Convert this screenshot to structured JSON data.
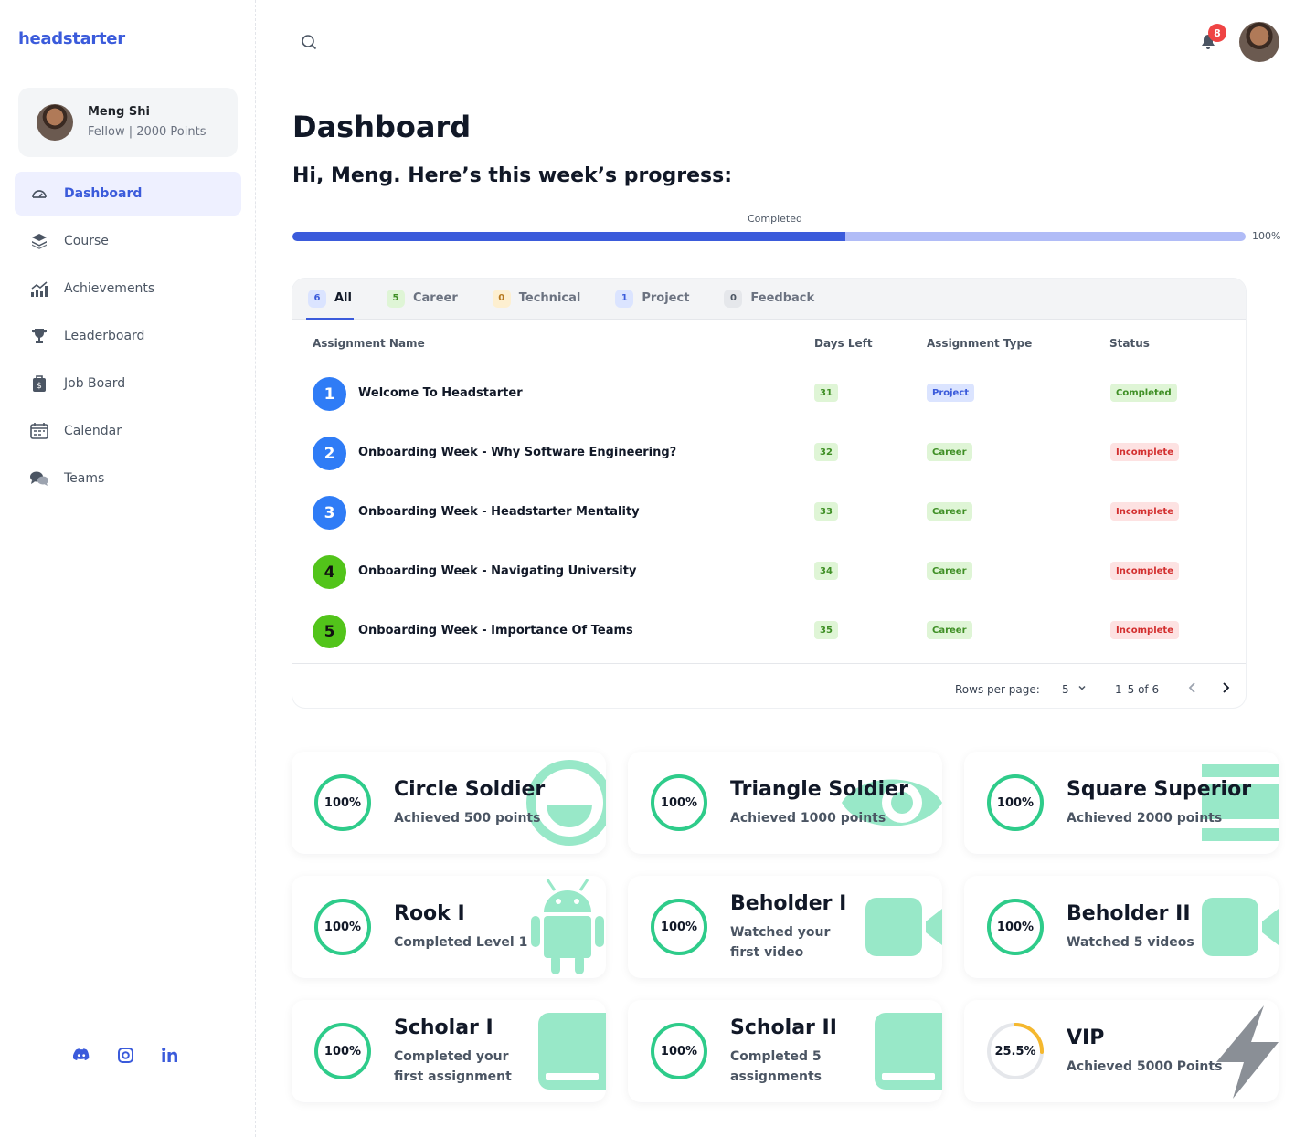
{
  "brand": "headstarter",
  "profile": {
    "name": "Meng Shi",
    "meta": "Fellow | 2000 Points"
  },
  "nav": [
    {
      "label": "Dashboard",
      "icon": "gauge-icon",
      "active": true
    },
    {
      "label": "Course",
      "icon": "layers-icon"
    },
    {
      "label": "Achievements",
      "icon": "chart-icon"
    },
    {
      "label": "Leaderboard",
      "icon": "trophy-icon"
    },
    {
      "label": "Job Board",
      "icon": "briefcase-icon"
    },
    {
      "label": "Calendar",
      "icon": "calendar-icon"
    },
    {
      "label": "Teams",
      "icon": "chat-icon"
    }
  ],
  "socials": [
    "discord-icon",
    "instagram-icon",
    "linkedin-icon"
  ],
  "notifications": {
    "count": "8"
  },
  "page": {
    "title": "Dashboard",
    "greeting": "Hi, Meng. Here’s this week’s progress:"
  },
  "progress": {
    "label": "Completed",
    "percent_text": "100%",
    "fill_fraction": 0.58
  },
  "tabs": [
    {
      "count": "6",
      "label": "All",
      "active": true
    },
    {
      "count": "5",
      "label": "Career"
    },
    {
      "count": "0",
      "label": "Technical"
    },
    {
      "count": "1",
      "label": "Project"
    },
    {
      "count": "0",
      "label": "Feedback"
    }
  ],
  "columns": [
    "Assignment Name",
    "Days Left",
    "Assignment Type",
    "Status"
  ],
  "assignments": [
    {
      "n": "1",
      "name": "Welcome To Headstarter",
      "days": "31",
      "type": "Project",
      "status": "Completed"
    },
    {
      "n": "2",
      "name": "Onboarding Week - Why Software Engineering?",
      "days": "32",
      "type": "Career",
      "status": "Incomplete"
    },
    {
      "n": "3",
      "name": "Onboarding Week - Headstarter Mentality",
      "days": "33",
      "type": "Career",
      "status": "Incomplete"
    },
    {
      "n": "4",
      "name": "Onboarding Week - Navigating University",
      "days": "34",
      "type": "Career",
      "status": "Incomplete"
    },
    {
      "n": "5",
      "name": "Onboarding Week - Importance Of Teams",
      "days": "35",
      "type": "Career",
      "status": "Incomplete"
    }
  ],
  "pagination": {
    "rows_label": "Rows per page:",
    "rows_value": "5",
    "range": "1–5 of 6"
  },
  "achievements": [
    {
      "pct": "100%",
      "progress": 1.0,
      "title": "Circle Soldier",
      "desc": "Achieved 500 points",
      "art": "smile-icon"
    },
    {
      "pct": "100%",
      "progress": 1.0,
      "title": "Triangle Soldier",
      "desc": "Achieved 1000 points",
      "art": "eye-icon"
    },
    {
      "pct": "100%",
      "progress": 1.0,
      "title": "Square Superior",
      "desc": "Achieved 2000 points",
      "art": "bars-icon"
    },
    {
      "pct": "100%",
      "progress": 1.0,
      "title": "Rook I",
      "desc": "Completed Level 1",
      "art": "android-icon"
    },
    {
      "pct": "100%",
      "progress": 1.0,
      "title": "Beholder I",
      "desc": "Watched your first video",
      "art": "video-icon"
    },
    {
      "pct": "100%",
      "progress": 1.0,
      "title": "Beholder II",
      "desc": "Watched 5 videos",
      "art": "video-icon"
    },
    {
      "pct": "100%",
      "progress": 1.0,
      "title": "Scholar I",
      "desc": "Completed your first assignment",
      "art": "book-icon"
    },
    {
      "pct": "100%",
      "progress": 1.0,
      "title": "Scholar II",
      "desc": "Completed  5 assignments",
      "art": "book-icon"
    },
    {
      "pct": "25.5%",
      "progress": 0.255,
      "title": "VIP",
      "desc": "Achieved 5000 Points",
      "art": "bolt-icon"
    }
  ],
  "colors": {
    "accent": "#3b5bdb",
    "ring_done": "#2ecc8a",
    "ring_partial": "#f5b82e",
    "art": "#98e8c8",
    "num_blue": "#2f7cf6",
    "num_green": "#52c41a"
  }
}
